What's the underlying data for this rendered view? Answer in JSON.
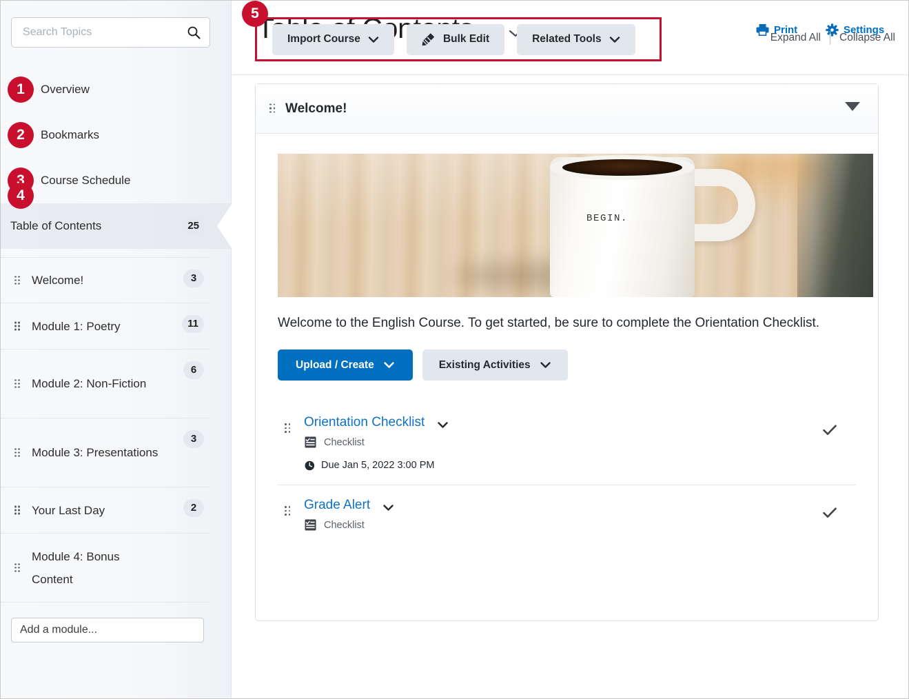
{
  "sidebar": {
    "search": {
      "placeholder": "Search Topics",
      "value": "",
      "icon": "search-icon"
    },
    "nav_items": [
      {
        "badge": "1",
        "label": "Overview"
      },
      {
        "badge": "2",
        "label": "Bookmarks"
      },
      {
        "badge": "3",
        "label": "Course Schedule"
      }
    ],
    "toc": {
      "badge": "4",
      "label": "Table of Contents",
      "count": "25",
      "active": true
    },
    "modules": [
      {
        "label": "Welcome!",
        "count": "3"
      },
      {
        "label": "Module 1: Poetry",
        "count": "11"
      },
      {
        "label": "Module 2: Non-Fiction",
        "count": "6"
      },
      {
        "label": "Module 3: Presentations",
        "count": "3"
      },
      {
        "label": "Your Last Day",
        "count": "2"
      },
      {
        "label": "Module 4: Bonus Content",
        "count": ""
      }
    ],
    "add_module": {
      "placeholder": "Add a module...",
      "value": ""
    }
  },
  "header": {
    "title": "Table of Contents",
    "title_caret_icon": "chevron-down-icon",
    "print_label": "Print",
    "print_icon": "printer-icon",
    "settings_label": "Settings",
    "settings_icon": "gear-icon"
  },
  "toolbar": {
    "callout_badge": "5",
    "buttons": [
      {
        "label": "Import Course",
        "icon": "chevron-down-icon",
        "has_caret": true,
        "leading_icon": ""
      },
      {
        "label": "Bulk Edit",
        "icon": "",
        "has_caret": false,
        "leading_icon": "pencil-icon"
      },
      {
        "label": "Related Tools",
        "icon": "chevron-down-icon",
        "has_caret": true,
        "leading_icon": ""
      }
    ],
    "expand_all": "Expand All",
    "collapse_all": "Collapse All",
    "highlight_color": "#c8102e"
  },
  "card": {
    "title": "Welcome!",
    "collapse_icon": "triangle-down-icon",
    "image": {
      "alt": "white coffee mug with BEGIN. text on wooden table",
      "mug_text": "BEGIN."
    },
    "description": "Welcome to the English Course. To get started, be sure to complete the Orientation Checklist.",
    "primary_button": {
      "label": "Upload / Create",
      "icon": "chevron-down-icon",
      "color": "#006fbf"
    },
    "secondary_button": {
      "label": "Existing Activities",
      "icon": "chevron-down-icon"
    },
    "items": [
      {
        "title": "Orientation Checklist",
        "caret_icon": "chevron-down-icon",
        "type_icon": "checklist-icon",
        "type": "Checklist",
        "due_icon": "clock-icon",
        "due": "Due Jan 5, 2022 3:00 PM",
        "status_icon": "check-icon"
      },
      {
        "title": "Grade Alert",
        "caret_icon": "chevron-down-icon",
        "type_icon": "checklist-icon",
        "type": "Checklist",
        "due_icon": "",
        "due": "",
        "status_icon": "check-icon"
      }
    ]
  },
  "colors": {
    "accent_blue": "#006fbf",
    "link_blue": "#1072c0",
    "callout_red": "#c8102e",
    "chip_gray": "#e4e9ef"
  }
}
